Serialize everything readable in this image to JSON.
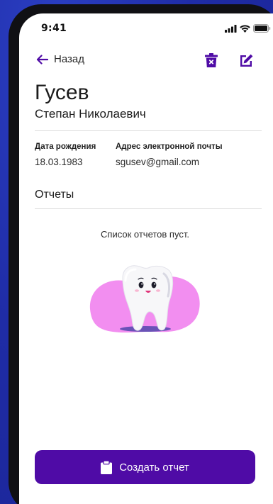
{
  "status_bar": {
    "time": "9:41"
  },
  "nav": {
    "back_label": "Назад",
    "back_icon": "arrow-left-icon",
    "delete_icon": "trash-icon",
    "edit_icon": "edit-icon"
  },
  "patient": {
    "last_name": "Гусев",
    "first_names": "Степан Николаевич"
  },
  "fields": {
    "birth_date_label": "Дата рождения",
    "birth_date_value": "18.03.1983",
    "email_label": "Адрес электронной почты",
    "email_value": "sgusev@gmail.com"
  },
  "reports": {
    "title": "Отчеты",
    "empty_text": "Список отчетов пуст."
  },
  "actions": {
    "create_label": "Создать отчет",
    "create_icon": "clipboard-icon"
  },
  "colors": {
    "accent": "#4f0ba6",
    "background": "#1f2ca6",
    "illustration_blob": "#f28ef0"
  }
}
